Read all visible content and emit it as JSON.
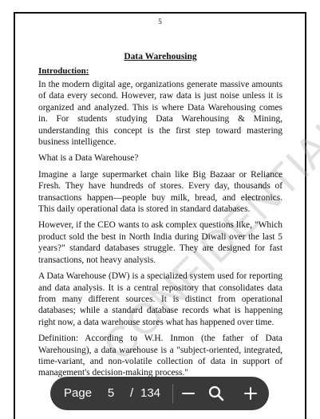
{
  "document": {
    "page_number": "5",
    "watermark": "CONFIDENTIAL",
    "title": "Data Warehousing",
    "intro_heading": "Introduction:",
    "paragraphs": [
      "In the modern digital age, organizations generate massive amounts of data every second. However, raw data is just noise unless it is organized and analyzed. This is where Data Warehousing comes in. For students studying Data Warehousing & Mining, understanding this concept is the first step toward mastering business intelligence.",
      "What is a Data Warehouse?",
      "Imagine a large supermarket chain like Big Bazaar or Reliance Fresh. They have hundreds of stores. Every day, thousands of transactions happen—people buy milk, bread, and electronics. This daily operational data is stored in standard databases.",
      "However, if the CEO wants to ask complex questions like, \"Which product sold the best in North India during Diwali over the last 5 years?\" standard databases struggle. They are designed for fast transactions, not heavy analysis.",
      "A Data Warehouse (DW) is a specialized system used for reporting and data analysis. It is a central repository that consolidates data from many different sources. It is distinct from operational databases; while a standard database records what is happening right now, a data warehouse stores what has happened over time.",
      "Definition: According to W.H. Inmon (the father of Data Warehousing), a data warehouse is a \"subject-oriented, integrated, time-variant, and non-volatile collection of data in support of management's decision-making process.\""
    ]
  },
  "toolbar": {
    "page_label": "Page",
    "current_page": "5",
    "separator": "/",
    "total_pages": "134",
    "zoom_out_icon": "minus-icon",
    "search_icon": "magnifier-icon",
    "zoom_in_icon": "plus-icon"
  }
}
